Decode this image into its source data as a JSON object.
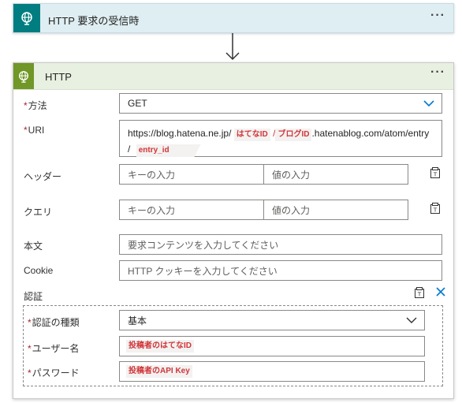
{
  "trigger": {
    "title": "HTTP 要求の受信時",
    "more": "···"
  },
  "http_action": {
    "title": "HTTP",
    "more": "···",
    "method": {
      "label": "方法",
      "required_mark": "*",
      "value": "GET"
    },
    "uri": {
      "label": "URI",
      "required_mark": "*",
      "line1_text": "https://blog.hatena.ne.jp/",
      "token_hatena_id": "はてなID",
      "sep": "/",
      "token_blog_id": "ブログID",
      "line1_suffix": ".hatenablog.com/atom/entry",
      "line2_prefix": "/",
      "token_entry_id": "entry_id"
    },
    "headers": {
      "label": "ヘッダー",
      "key_placeholder": "キーの入力",
      "value_placeholder": "値の入力"
    },
    "query": {
      "label": "クエリ",
      "key_placeholder": "キーの入力",
      "value_placeholder": "値の入力"
    },
    "body": {
      "label": "本文",
      "placeholder": "要求コンテンツを入力してください"
    },
    "cookie": {
      "label": "Cookie",
      "placeholder": "HTTP クッキーを入力してください"
    },
    "auth": {
      "label": "認証",
      "type": {
        "label": "認証の種類",
        "required_mark": "*",
        "value": "基本"
      },
      "username": {
        "label": "ユーザー名",
        "required_mark": "*",
        "token": "投稿者のはてなID"
      },
      "password": {
        "label": "パスワード",
        "required_mark": "*",
        "token": "投稿者のAPI Key"
      }
    }
  },
  "colors": {
    "trigger_accent": "#007d80",
    "http_accent": "#709727",
    "chevron": "#0078d4",
    "token_text": "#d13438"
  },
  "icons": [
    "globe-icon",
    "more-icon",
    "chevron-down-icon",
    "switch-to-text-icon",
    "close-icon",
    "arrow-down-icon"
  ]
}
